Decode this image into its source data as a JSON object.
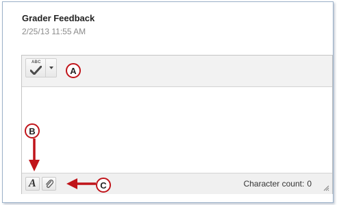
{
  "feedback": {
    "title": "Grader Feedback",
    "date": "2/25/13 11:55 AM"
  },
  "editor": {
    "spellcheck_label": "ABC",
    "text_format_glyph": "A",
    "character_count_label": "Character count:",
    "character_count_value": "0"
  },
  "annotations": {
    "callout_a": "A",
    "callout_b": "B",
    "callout_c": "C",
    "arrow_color": "#c0141a"
  },
  "icons": {
    "spellcheck": "spellcheck-icon",
    "dropdown": "chevron-down-icon",
    "text_format": "text-format-icon",
    "attach": "paperclip-icon",
    "resize": "resize-grip-icon"
  }
}
